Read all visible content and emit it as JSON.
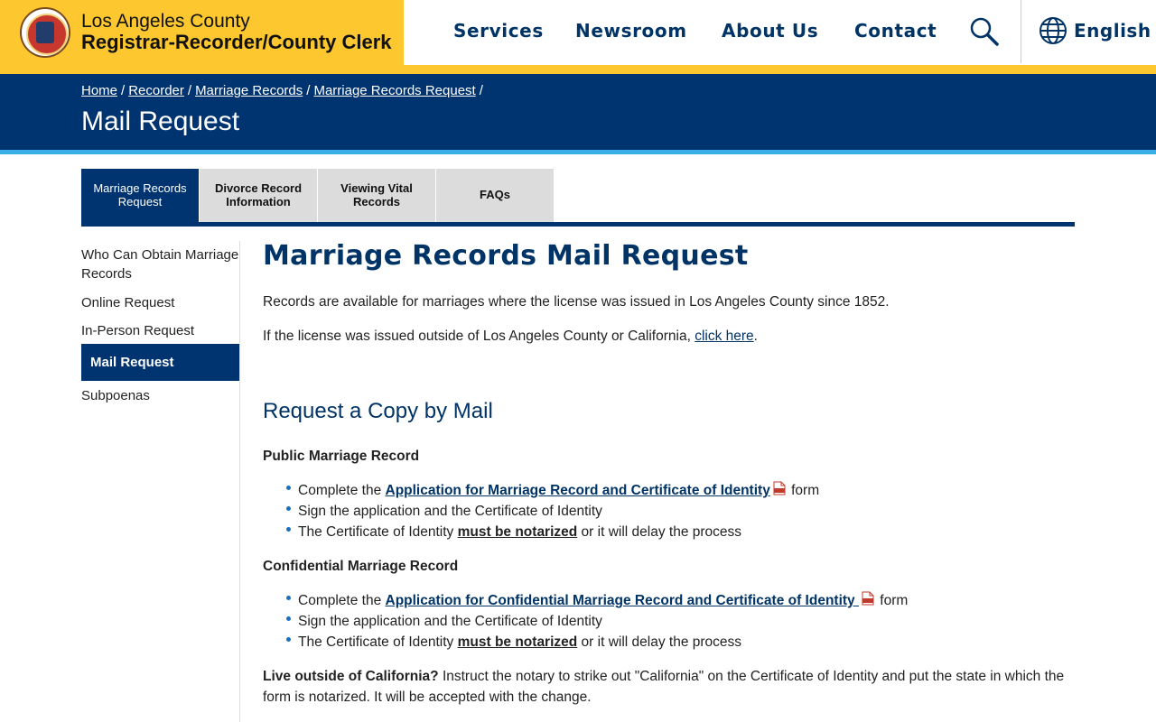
{
  "header": {
    "brand_line1": "Los Angeles County",
    "brand_line2": "Registrar-Recorder/County Clerk",
    "nav": [
      "Services",
      "Newsroom",
      "About Us",
      "Contact"
    ],
    "language_label": "English",
    "icons": {
      "search": "search-icon",
      "language": "globe-icon",
      "logo": "county-seal"
    },
    "colors": {
      "brand_yellow": "#fdc82f",
      "navy": "#003471",
      "accent_blue": "#3aaee8",
      "nav_text": "#003366"
    }
  },
  "banner": {
    "breadcrumb": [
      "Home",
      "Recorder",
      "Marriage Records",
      "Marriage Records Request"
    ],
    "breadcrumb_separator": "/",
    "title": "Mail Request"
  },
  "tabs": [
    {
      "label": "Marriage Records Request",
      "active": true
    },
    {
      "label": "Divorce Record Information",
      "active": false
    },
    {
      "label": "Viewing Vital Records",
      "active": false
    },
    {
      "label": "FAQs",
      "active": false
    }
  ],
  "sidebar": {
    "items": [
      "Who Can Obtain Marriage Records",
      "Online Request",
      "In-Person Request",
      "Mail Request",
      "Subpoenas"
    ],
    "active_item": "Mail Request"
  },
  "main": {
    "title": "Marriage Records Mail Request",
    "intro": "Records are available for marriages where the license was issued in Los Angeles County since 1852.",
    "outside_prefix": "If the license was issued outside of Los Angeles County or California, ",
    "outside_link": "click here",
    "outside_suffix": ".",
    "section_title": "Request a Copy by Mail",
    "public": {
      "title": "Public Marriage Record",
      "step1_prefix": "Complete the ",
      "step1_link": "Application for Marriage Record and Certificate of Identity",
      "step1_suffix": " form",
      "step2": "Sign the application and the Certificate of Identity",
      "step3_prefix": "The Certificate of Identity ",
      "step3_emphasis": "must be notarized",
      "step3_suffix": " or it will delay the process"
    },
    "confidential": {
      "title": "Confidential Marriage Record",
      "step1_prefix": "Complete the ",
      "step1_link": "Application for Confidential Marriage Record and Certificate of Identity ",
      "step1_suffix": " form",
      "step2": "Sign the application and the Certificate of Identity",
      "step3_prefix": "The Certificate of Identity ",
      "step3_emphasis": "must be notarized",
      "step3_suffix": " or it will delay the process"
    },
    "note_bold": "Live outside of California?",
    "note_text": " Instruct the notary to strike out \"California\" on the Certificate of Identity and put the state in which the form is notarized. It will be accepted with the change.",
    "pdf_icon": "pdf-icon"
  }
}
